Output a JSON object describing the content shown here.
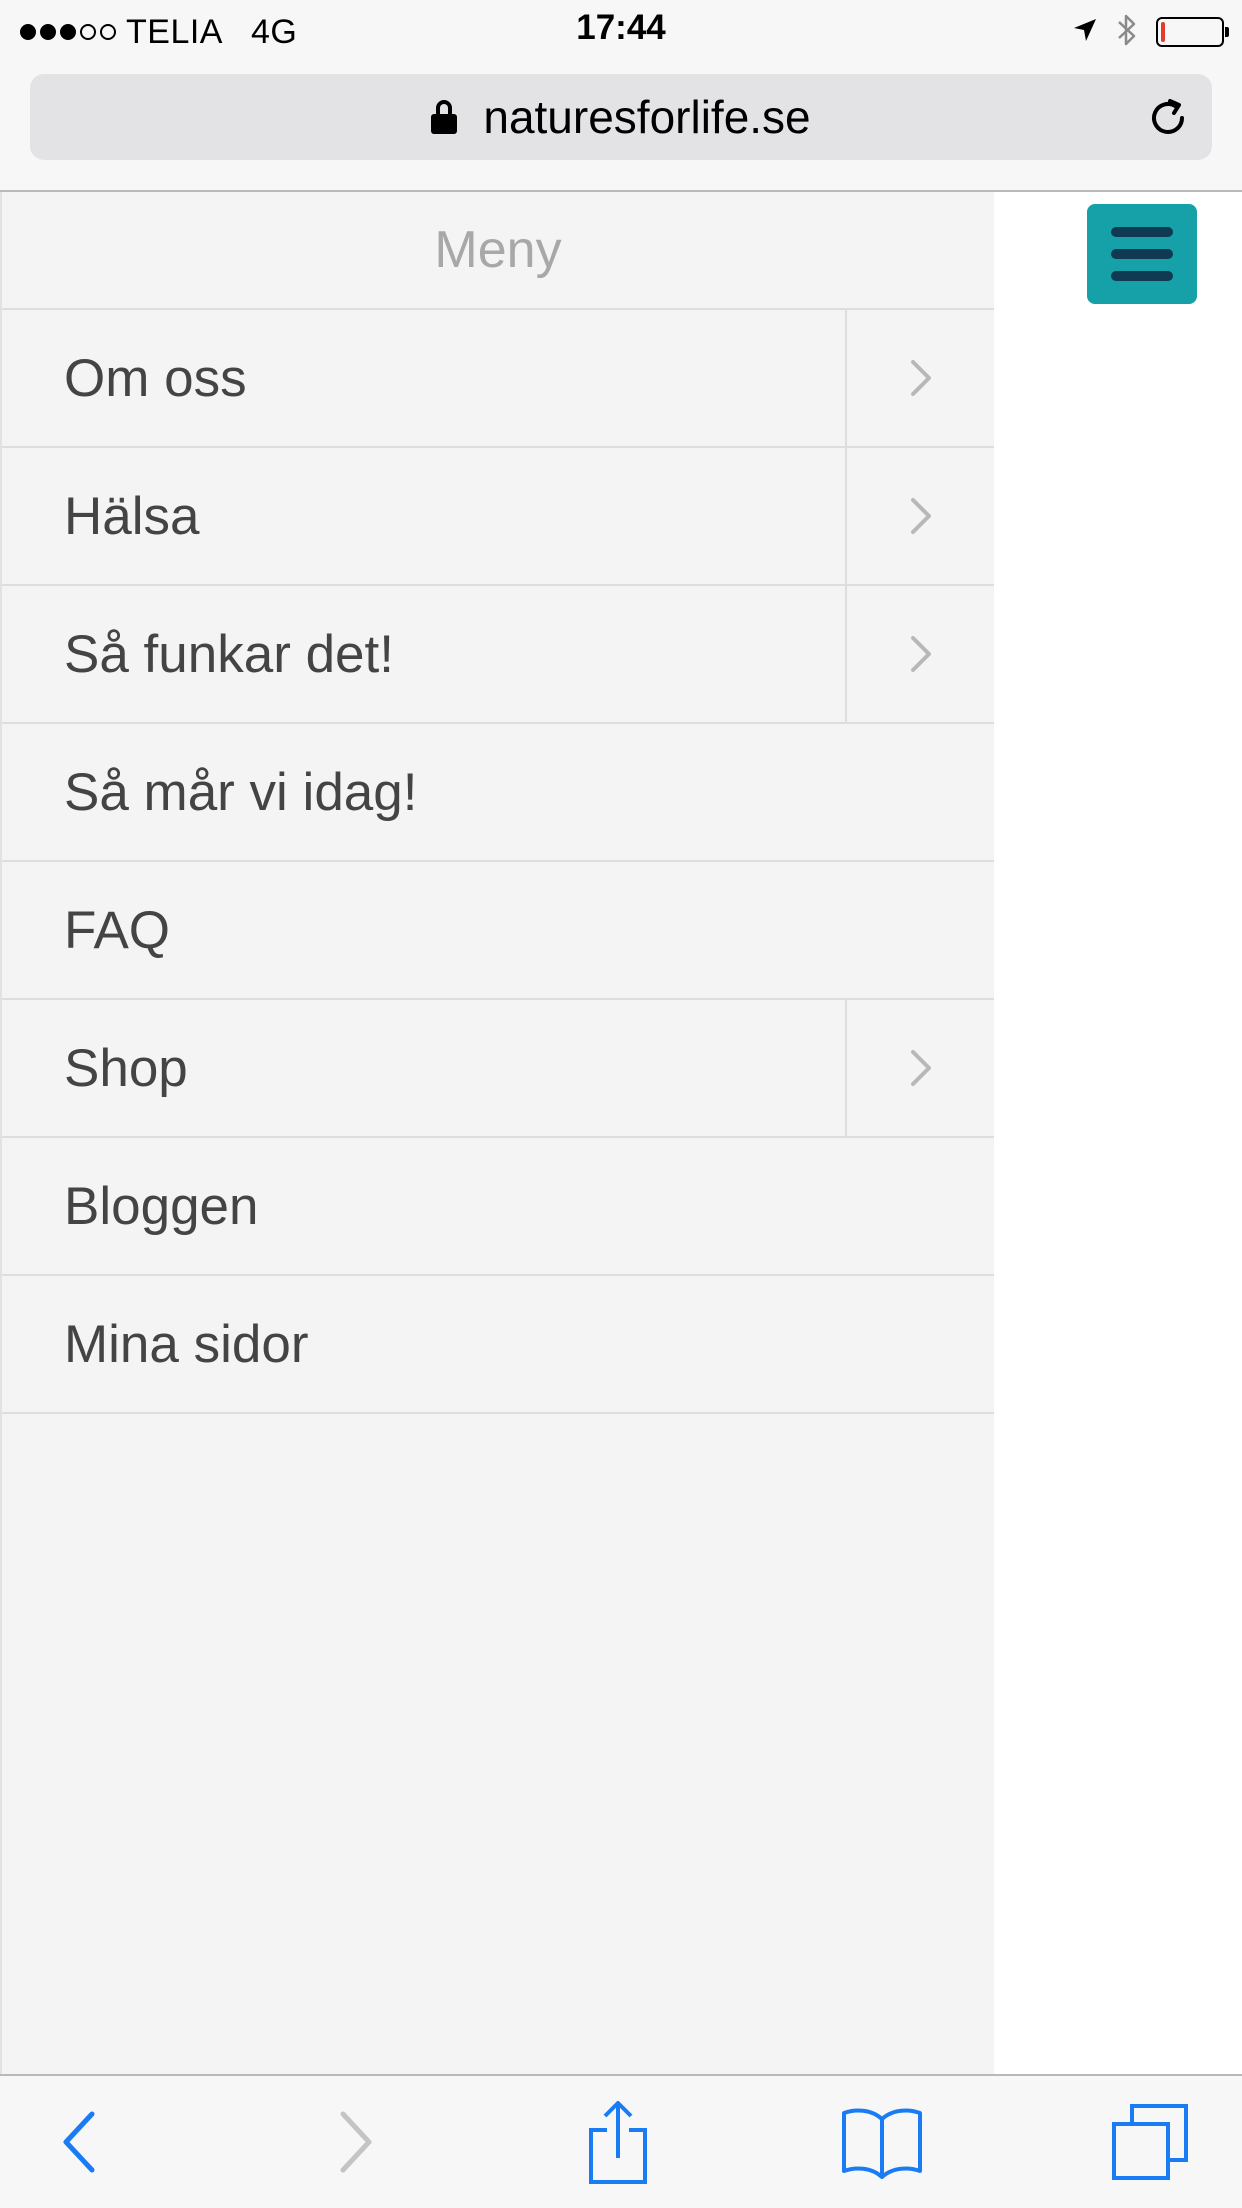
{
  "status_bar": {
    "carrier": "TELIA",
    "network": "4G",
    "time": "17:44",
    "signal_bars_filled": 3,
    "signal_bars_total": 5,
    "battery_level": 0.05,
    "icons": [
      "location-icon",
      "bluetooth-icon",
      "battery-icon"
    ]
  },
  "address_bar": {
    "url": "naturesforlife.se",
    "secure": true
  },
  "menu": {
    "title": "Meny",
    "items": [
      {
        "label": "Om oss",
        "has_submenu": true
      },
      {
        "label": "Hälsa",
        "has_submenu": true
      },
      {
        "label": "Så funkar det!",
        "has_submenu": true
      },
      {
        "label": "Så mår vi idag!",
        "has_submenu": false
      },
      {
        "label": "FAQ",
        "has_submenu": false
      },
      {
        "label": "Shop",
        "has_submenu": true
      },
      {
        "label": "Bloggen",
        "has_submenu": false
      },
      {
        "label": "Mina sidor",
        "has_submenu": false
      }
    ]
  },
  "toolbar": {
    "buttons": [
      "back-icon",
      "forward-icon",
      "share-icon",
      "bookmarks-icon",
      "tabs-icon"
    ]
  },
  "colors": {
    "accent": "#16a0a8",
    "toggle_bars": "#0f3a52",
    "ios_blue": "#1a7cf5",
    "menu_bg": "#f4f4f4",
    "menu_text": "#444444",
    "menu_title": "#a8a8a8"
  }
}
